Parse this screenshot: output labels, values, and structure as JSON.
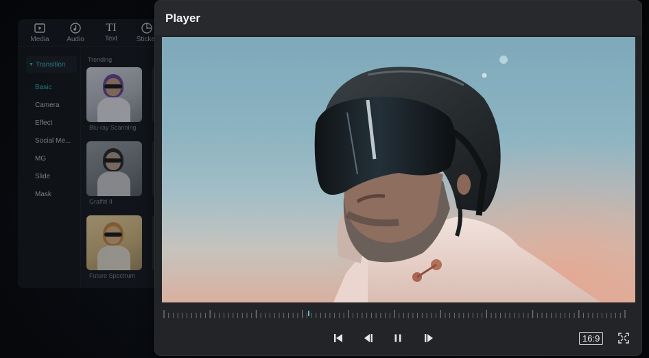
{
  "editor": {
    "tools": [
      {
        "label": "Media",
        "icon": "media-icon"
      },
      {
        "label": "Audio",
        "icon": "audio-icon"
      },
      {
        "label": "Text",
        "icon": "text-icon",
        "glyph": "TI"
      },
      {
        "label": "Sticker",
        "icon": "sticker-icon"
      }
    ],
    "category_header": "Transition",
    "categories": [
      "Basic",
      "Camera",
      "Effect",
      "Social Me...",
      "MG",
      "Slide",
      "Mask"
    ],
    "active_category": "Basic",
    "section_title": "Trending",
    "thumbnails": [
      {
        "name": "Blu-ray Scanning"
      },
      {
        "name": "Graffiti II"
      },
      {
        "name": "Future Spectrum"
      }
    ],
    "accent_color": "#2cc1c9"
  },
  "player": {
    "title": "Player",
    "aspect_ratio_label": "16:9",
    "controls": {
      "prev_clip": "skip-to-start-icon",
      "prev_frame": "step-back-icon",
      "pause": "pause-icon",
      "next_frame": "step-forward-icon",
      "fullscreen": "fullscreen-icon"
    }
  }
}
